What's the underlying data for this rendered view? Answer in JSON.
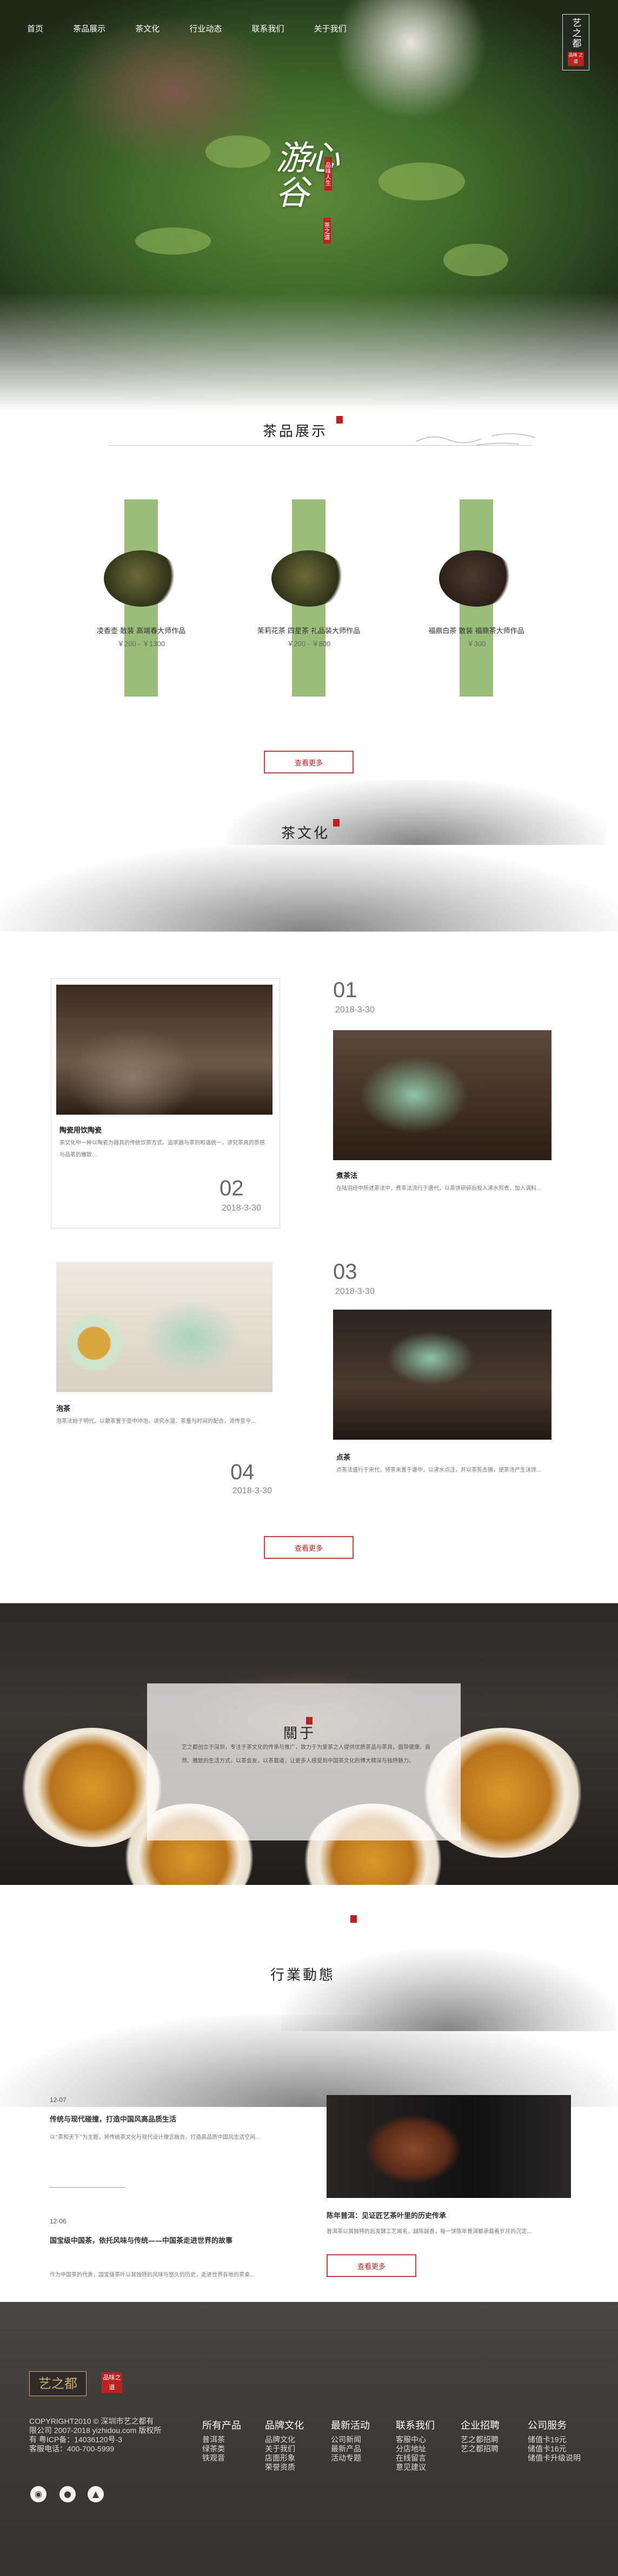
{
  "nav": {
    "items": [
      "首页",
      "茶品展示",
      "茶文化",
      "行业动态",
      "联系我们",
      "关于我们"
    ]
  },
  "logo": {
    "text": "艺之都",
    "seal": "品味 之道"
  },
  "hero": {
    "brand": "游心谷",
    "seal_top": "品味人生",
    "seal_bottom": "茶之道"
  },
  "products": {
    "title": "茶品展示",
    "items": [
      {
        "name": "凌香壶 散装 高端春大师作品",
        "price": "￥200 - ￥1300"
      },
      {
        "name": "茉莉花茶 四星茶 礼品装大师作品",
        "price": "￥200 - ￥800"
      },
      {
        "name": "福鼎白茶 散装 福鼎茶大师作品",
        "price": "￥300"
      }
    ],
    "more": "查看更多"
  },
  "culture": {
    "title": "茶文化",
    "cards": [
      {
        "num": "01",
        "date": "2018-3-30",
        "title": "煮茶法",
        "desc": "在陆羽经中所述茶法中，煮茶法流行于唐代，以茶饼研碎后投入沸水煎煮，加入调料..."
      },
      {
        "num": "02",
        "date": "2018-3-30",
        "title": "陶瓷用饮陶瓷",
        "desc": "茶文化中一种以陶瓷为器具的传统饮茶方式，追求器与茶的和谐统一，讲究茶具的质感与品茗的雅致..."
      },
      {
        "num": "03",
        "date": "2018-3-30",
        "title": "点茶",
        "desc": "点茶法盛行于宋代，将茶末置于盏中，以沸水点注，并以茶筅击拂，使茶汤产生沫饽..."
      },
      {
        "num": "04",
        "date": "2018-3-30",
        "title": "泡茶",
        "desc": "泡茶法始于明代，以散茶置于壶中冲泡，讲究水温、茶量与时间的配合，流传至今..."
      }
    ],
    "more": "查看更多"
  },
  "about": {
    "title": "關于",
    "text": "艺之都创立于深圳，专注于茶文化的传承与推广，致力于为爱茶之人提供优质茶品与茶具，倡导健康、自然、雅致的生活方式，以茶会友，以茶载道，让更多人感受到中国茶文化的博大精深与独特魅力。"
  },
  "industry": {
    "title": "行業動態",
    "news": [
      {
        "date": "12-07",
        "title": "传统与现代碰撞，打造中国风高品质生活",
        "desc": "以“茶和天下”为主题，将传统茶文化与现代设计理念融合，打造高品质中国风生活空间..."
      },
      {
        "date": "12-06",
        "title": "国宝级中国茶，依托风味与传统——中国茶走进世界的故事",
        "desc": "作为中国茶的代表，国宝级茶叶以其独特的风味与悠久的历史，走进世界各地的茶桌..."
      }
    ],
    "feature": {
      "title": "陈年普洱：见证匠艺茶叶里的历史传承",
      "desc": "普洱茶以其独特的后发酵工艺闻名，越陈越香，每一饼陈年普洱都承载着岁月的沉淀..."
    },
    "more": "查看更多"
  },
  "footer": {
    "logo": "艺之都",
    "seal": "品味之道",
    "copyright": [
      "COPYRIGHT2010 © 深圳市艺之都有",
      "限公司 2007-2018 yizhidou.com 版权所",
      "有 粤ICP备：14036120号-3",
      "客服电话：400-700-5999"
    ],
    "cols": [
      {
        "h": "所有产品",
        "i": [
          "普洱茶",
          "绿茶类",
          "铁观音"
        ]
      },
      {
        "h": "品牌文化",
        "i": [
          "品牌文化",
          "关于我们",
          "店面形象",
          "荣誉资质"
        ]
      },
      {
        "h": "最新活动",
        "i": [
          "公司新闻",
          "最新产品",
          "活动专题"
        ]
      },
      {
        "h": "联系我们",
        "i": [
          "客服中心",
          "分店地址",
          "在线留言",
          "意见建议"
        ]
      },
      {
        "h": "企业招聘",
        "i": [
          "艺之都招聘",
          "艺之都招聘"
        ]
      },
      {
        "h": "公司服务",
        "i": [
          "储值卡19元",
          "储值卡16元",
          "储值卡升级说明"
        ]
      }
    ]
  }
}
